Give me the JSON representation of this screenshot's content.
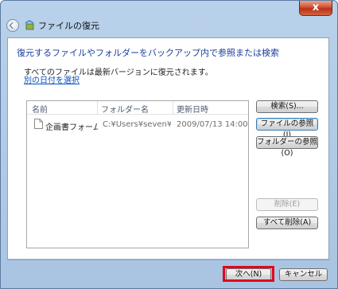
{
  "window": {
    "title": "ファイルの復元",
    "close_label": "x"
  },
  "main": {
    "heading": "復元するファイルやフォルダーをバックアップ内で参照または検索",
    "info": "すべてのファイルは最新バージョンに復元されます。",
    "link": "別の日付を選択"
  },
  "file_list": {
    "columns": [
      "名前",
      "フォルダー名",
      "更新日時"
    ],
    "rows": [
      {
        "name": "企画書フォーム",
        "folder": "C:¥Users¥seven¥Do...",
        "modified": "2009/07/13 14:00",
        "icon": "document-icon"
      }
    ]
  },
  "side_buttons": {
    "search": "検索(S)...",
    "browse_files": "ファイルの参照(I)",
    "browse_folders": "フォルダーの参照(O)",
    "remove": "削除(E)",
    "remove_all": "すべて削除(A)"
  },
  "footer": {
    "next": "次へ(N)",
    "cancel": "キャンセル"
  },
  "colors": {
    "heading": "#1a3e9c",
    "link": "#0a4fb7",
    "highlight": "#e0071d",
    "close_button": "#c8432a"
  }
}
